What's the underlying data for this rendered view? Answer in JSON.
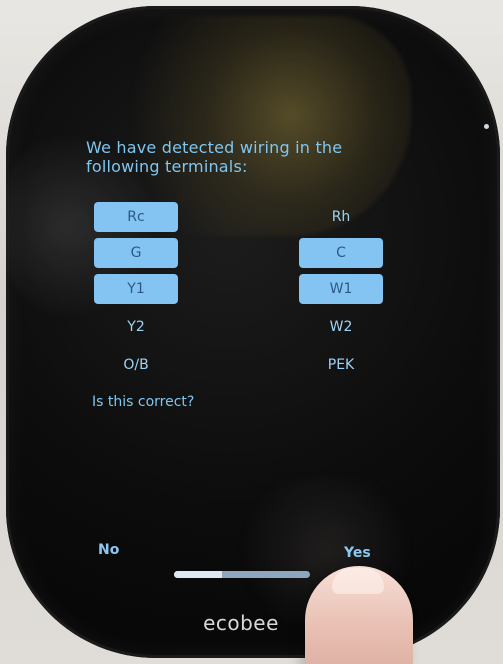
{
  "screen": {
    "title": "We have detected wiring in the following terminals:",
    "question": "Is this correct?",
    "terminals": {
      "left": [
        {
          "label": "Rc",
          "active": true
        },
        {
          "label": "G",
          "active": true
        },
        {
          "label": "Y1",
          "active": true
        },
        {
          "label": "Y2",
          "active": false
        },
        {
          "label": "O/B",
          "active": false
        }
      ],
      "right": [
        {
          "label": "Rh",
          "active": false
        },
        {
          "label": "C",
          "active": true
        },
        {
          "label": "W1",
          "active": true
        },
        {
          "label": "W2",
          "active": false
        },
        {
          "label": "PEK",
          "active": false
        }
      ]
    },
    "actions": {
      "no": "No",
      "yes": "Yes"
    },
    "progress": 0.35
  },
  "device": {
    "brand": "ecobee"
  },
  "colors": {
    "accent": "#84c4f3",
    "text": "#7fc6f0",
    "screen_bg": "#0c0c0d"
  }
}
